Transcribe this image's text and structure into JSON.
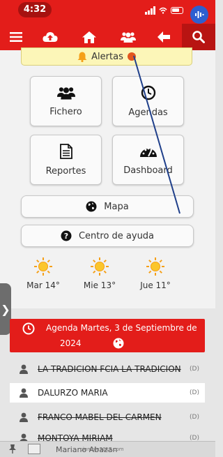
{
  "status_bar": {
    "time": "4:32"
  },
  "toolbar": {
    "menu_icon": "menu-icon",
    "upload_icon": "cloud-upload-icon",
    "home_icon": "home-icon",
    "users_icon": "users-icon",
    "back_icon": "arrow-left-icon",
    "search_icon": "search-icon"
  },
  "alert": {
    "label": "Alertas"
  },
  "tiles": [
    {
      "label": "Fichero",
      "icon": "users-icon"
    },
    {
      "label": "Agendas",
      "icon": "clock-icon"
    },
    {
      "label": "Reportes",
      "icon": "document-icon"
    },
    {
      "label": "Dashboard",
      "icon": "gauge-icon"
    }
  ],
  "buttons": {
    "map": {
      "label": "Mapa",
      "icon": "globe-icon"
    },
    "help": {
      "label": "Centro de ayuda",
      "icon": "question-icon"
    }
  },
  "weather": [
    {
      "day": "Mar 14°",
      "icon": "sun-icon"
    },
    {
      "day": "Mie 13°",
      "icon": "sun-icon"
    },
    {
      "day": "Jue 11°",
      "icon": "sun-icon"
    }
  ],
  "agenda": {
    "title": "Agenda Martes, 3 de Septiembre de",
    "year": "2024",
    "rows": [
      {
        "name": "LA TRADICION FCIA LA TRADICION",
        "tag": "(D)"
      },
      {
        "name": "DALURZO MARIA",
        "tag": "(D)"
      },
      {
        "name": "FRANCO MABEL DEL CARMEN",
        "tag": "(D)"
      },
      {
        "name": "MONTOYA MIRIAM",
        "tag": "(D)"
      }
    ]
  },
  "bottom": {
    "text": "Mariano Abazan",
    "url": "ciemple2017.com"
  },
  "colors": {
    "brand_red": "#e31d1a",
    "alert_bg": "#fcf6b8",
    "annotation_line": "#1f3f8a"
  }
}
